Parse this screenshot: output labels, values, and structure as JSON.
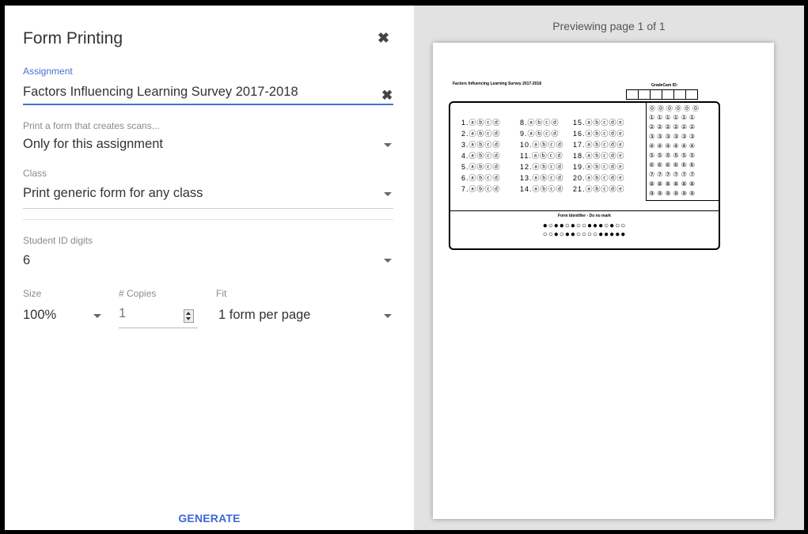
{
  "dialog": {
    "title": "Form Printing",
    "assignment": {
      "label": "Assignment",
      "value": "Factors Influencing Learning Survey 2017-2018"
    },
    "scans": {
      "label": "Print a form that creates scans...",
      "value": "Only for this assignment"
    },
    "class": {
      "label": "Class",
      "value": "Print generic form for any class"
    },
    "student_id": {
      "label": "Student ID digits",
      "value": "6"
    },
    "size": {
      "label": "Size",
      "value": "100%"
    },
    "copies": {
      "label": "# Copies",
      "value": "1"
    },
    "fit": {
      "label": "Fit",
      "value": "1 form per page"
    },
    "generate_label": "GENERATE"
  },
  "preview": {
    "status": "Previewing page 1 of 1",
    "sheet": {
      "title": "Factors Influencing Learning Survey 2017-2018",
      "gradecam_label": "GradeCam ID:",
      "form_identifier": "Form Identifier - Do no mark",
      "col1": [
        "1.ⓐⓑⓒⓓ",
        "2.ⓐⓑⓒⓓ",
        "3.ⓐⓑⓒⓓ",
        "4.ⓐⓑⓒⓓ",
        "5.ⓐⓑⓒⓓ",
        "6.ⓐⓑⓒⓓ",
        "7.ⓐⓑⓒⓓ"
      ],
      "col2": [
        "8.ⓐⓑⓒⓓ",
        "9.ⓐⓑⓒⓓ",
        "10.ⓐⓑⓒⓓ",
        "11.ⓐⓑⓒⓓ",
        "12.ⓐⓑⓒⓓ",
        "13.ⓐⓑⓒⓓ",
        "14.ⓐⓑⓒⓓ"
      ],
      "col3": [
        "15.ⓐⓑⓒⓓⓔ",
        "16.ⓐⓑⓒⓓⓔ",
        "17.ⓐⓑⓒⓓⓔ",
        "18.ⓐⓑⓒⓓⓔ",
        "19.ⓐⓑⓒⓓⓔ",
        "20.ⓐⓑⓒⓓⓔ",
        "21.ⓐⓑⓒⓓⓔ"
      ],
      "id_rows": [
        "⓪⓪⓪⓪⓪⓪",
        "①①①①①①",
        "②②②②②②",
        "③③③③③③",
        "④④④④④④",
        "⑤⑤⑤⑤⑤⑤",
        "⑥⑥⑥⑥⑥⑥",
        "⑦⑦⑦⑦⑦⑦",
        "⑧⑧⑧⑧⑧⑧",
        "⑨⑨⑨⑨⑨⑨"
      ],
      "id_bubbles_row1": "●○●●○●○○●●●○●○○",
      "id_bubbles_row2": "○○●○●●○○○○●●●●●"
    }
  }
}
